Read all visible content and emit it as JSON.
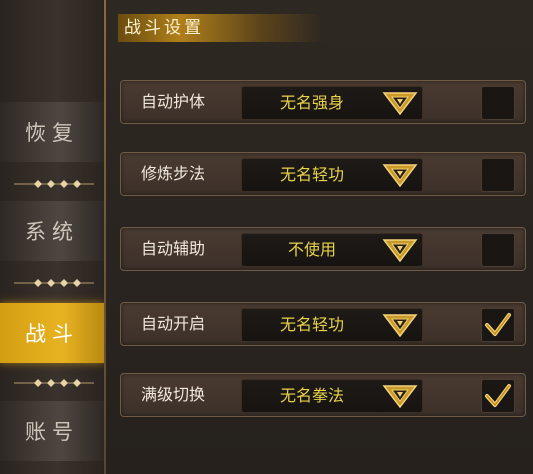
{
  "sidebar": {
    "tabs": [
      {
        "label": "恢复",
        "active": false
      },
      {
        "label": "系统",
        "active": false
      },
      {
        "label": "战斗",
        "active": true
      },
      {
        "label": "账号",
        "active": false
      }
    ]
  },
  "main": {
    "title": "战斗设置",
    "rows": [
      {
        "label": "自动护体",
        "value": "无名强身",
        "checked": false
      },
      {
        "label": "修炼步法",
        "value": "无名轻功",
        "checked": false
      },
      {
        "label": "自动辅助",
        "value": "不使用",
        "checked": false
      },
      {
        "label": "自动开启",
        "value": "无名轻功",
        "checked": true
      },
      {
        "label": "满级切换",
        "value": "无名拳法",
        "checked": true
      }
    ]
  },
  "colors": {
    "accent": "#e0a41a",
    "value_text": "#e8d34a"
  }
}
